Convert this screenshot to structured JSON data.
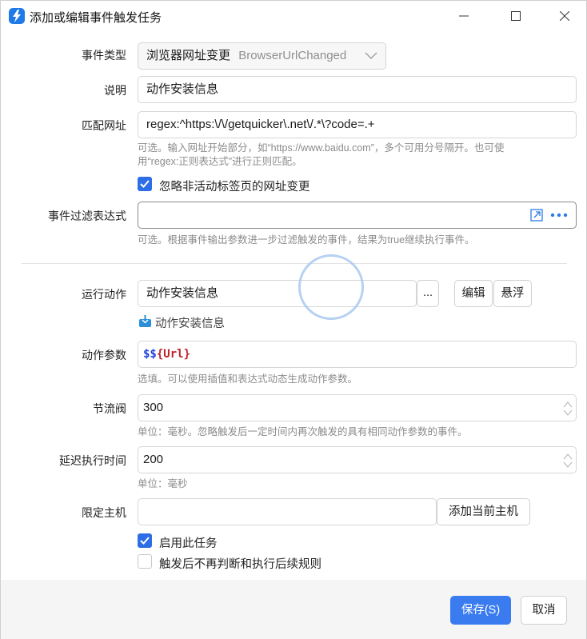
{
  "window": {
    "title": "添加或编辑事件触发任务"
  },
  "form": {
    "event_type": {
      "label": "事件类型",
      "value": "浏览器网址变更",
      "value_sub": "BrowserUrlChanged"
    },
    "description": {
      "label": "说明",
      "value": "动作安装信息"
    },
    "match_url": {
      "label": "匹配网址",
      "value": "regex:^https:\\/\\/getquicker\\.net\\/.*\\?code=.+",
      "hint_line1": "可选。输入网址开始部分，如“https://www.baidu.com”，多个可用分号隔开。也可使",
      "hint_line2": "用“regex:正则表达式”进行正则匹配。"
    },
    "ignore_inactive": {
      "label": "忽略非活动标签页的网址变更",
      "checked": true
    },
    "filter_expr": {
      "label": "事件过滤表达式",
      "value": "",
      "hint": "可选。根据事件输出参数进一步过滤触发的事件，结果为true继续执行事件。"
    },
    "run_action": {
      "label": "运行动作",
      "value": "动作安装信息",
      "browse_label": "...",
      "edit_label": "编辑",
      "float_label": "悬浮",
      "link_label": "动作安装信息"
    },
    "action_params": {
      "label": "动作参数",
      "prefix": "$$",
      "var": "{Url}",
      "hint": "选填。可以使用插值和表达式动态生成动作参数。"
    },
    "throttle": {
      "label": "节流阀",
      "value": "300",
      "hint": "单位：毫秒。忽略触发后一定时间内再次触发的具有相同动作参数的事件。"
    },
    "delay": {
      "label": "延迟执行时间",
      "value": "200",
      "hint": "单位：毫秒"
    },
    "host": {
      "label": "限定主机",
      "value": "",
      "add_label": "添加当前主机"
    },
    "enable_task": {
      "label": "启用此任务",
      "checked": true
    },
    "stop_after": {
      "label": "触发后不再判断和执行后续规则",
      "checked": false
    }
  },
  "footer": {
    "save_label": "保存(S)",
    "cancel_label": "取消"
  },
  "colors": {
    "accent": "#3a7bf0",
    "checkbox": "#2d6de6",
    "expr_dollar": "#1d3fd8",
    "expr_var": "#c0222b"
  }
}
